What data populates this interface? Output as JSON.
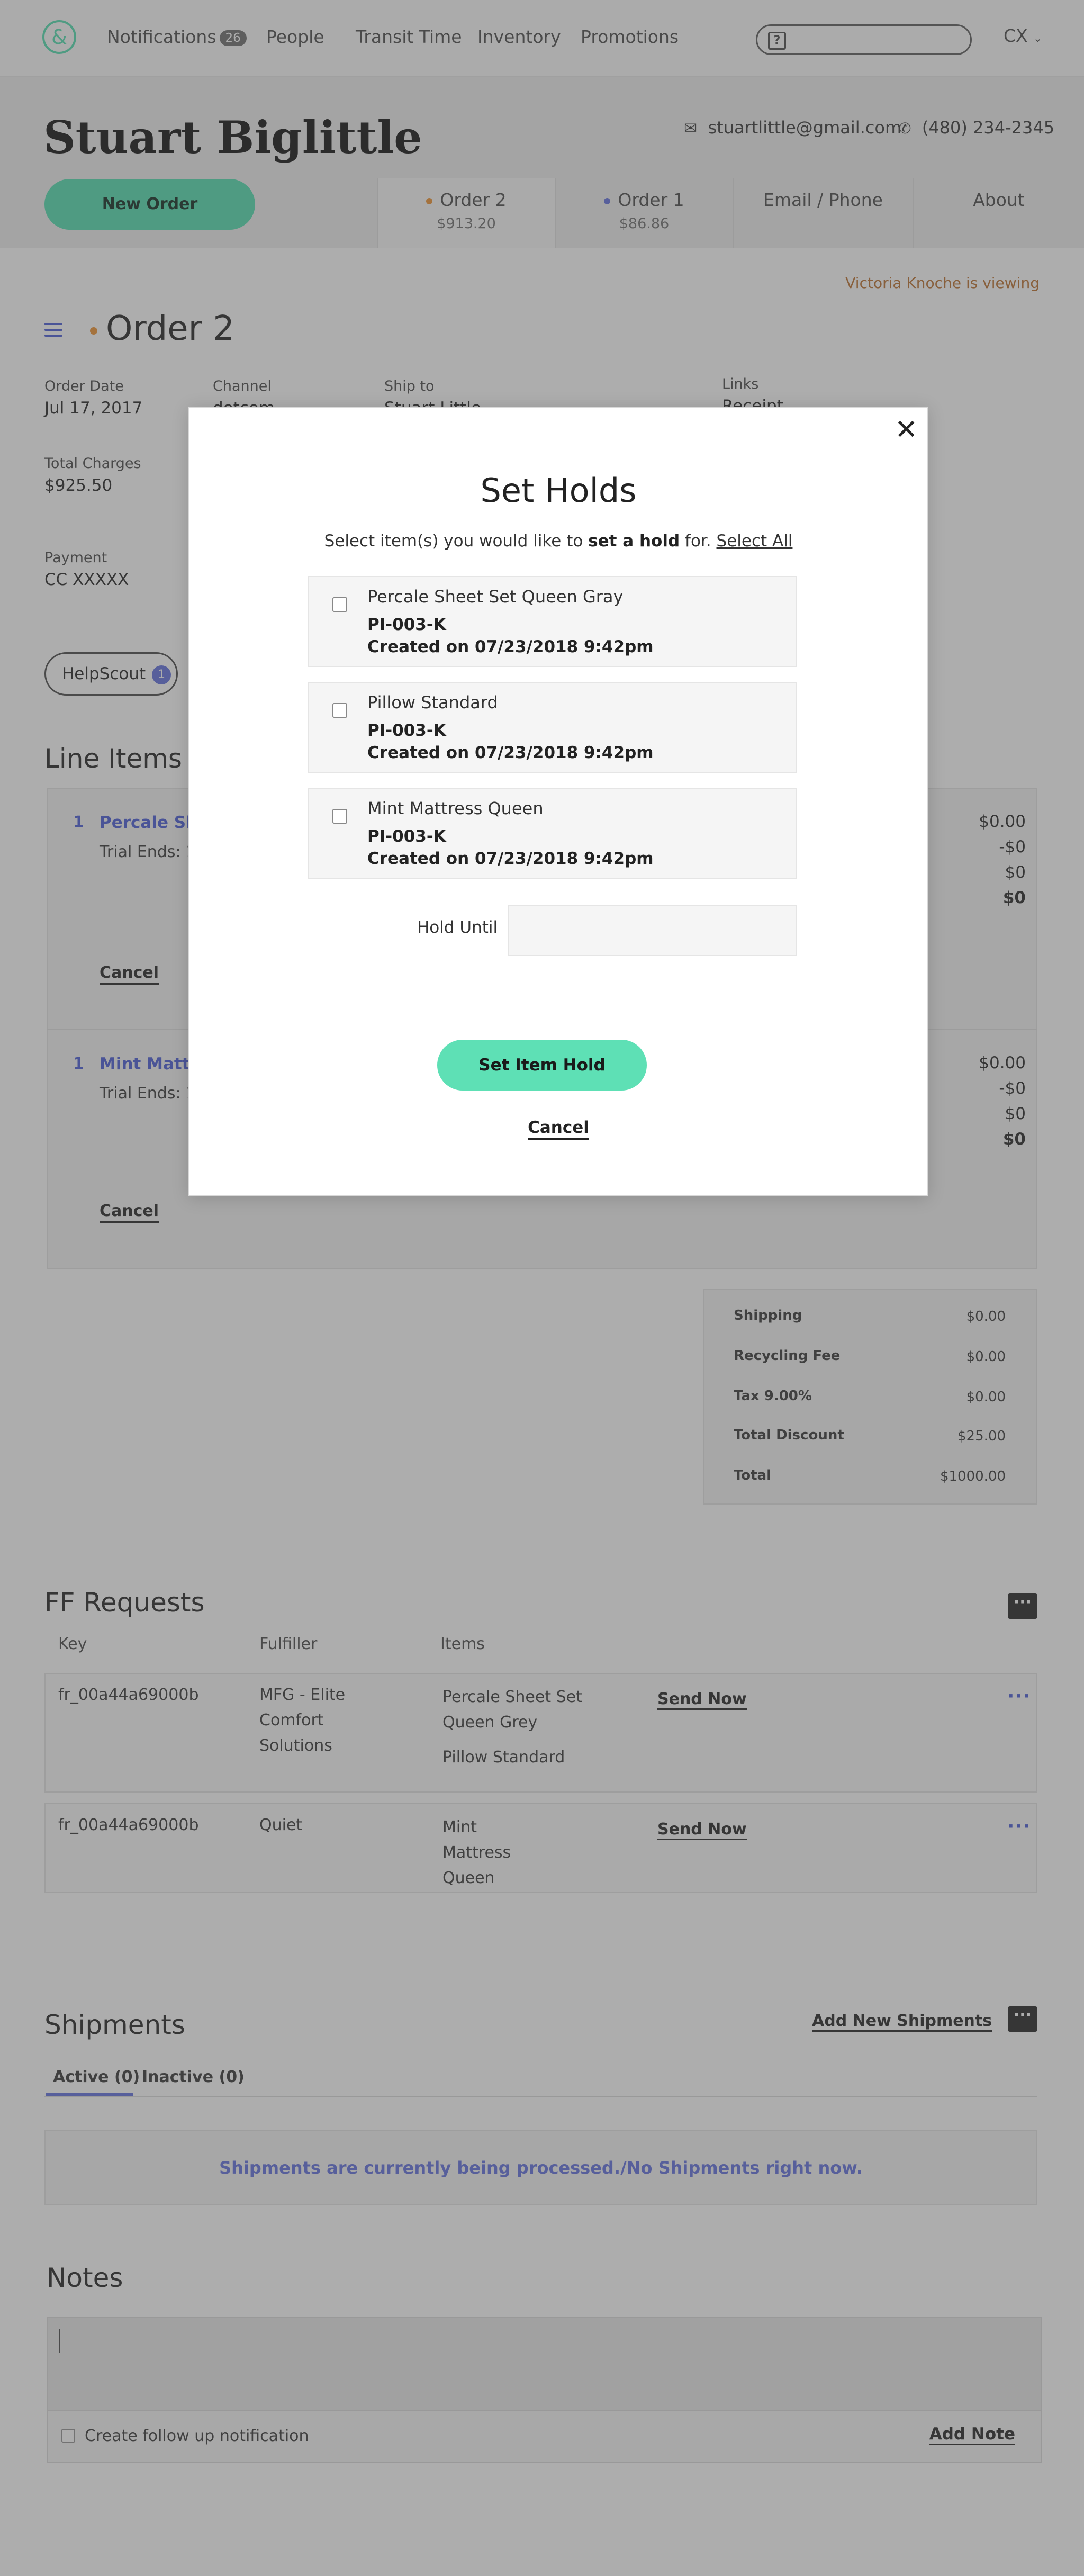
{
  "nav": {
    "logo": "&",
    "items": [
      "Notifications",
      "People",
      "Transit Time",
      "Inventory",
      "Promotions"
    ],
    "notif_count": "26",
    "search_icon": "?",
    "user_menu": "CX"
  },
  "customer": {
    "name": "Stuart Biglittle",
    "email": "stuartlittle@gmail.com",
    "phone": "(480) 234-2345",
    "new_order": "New Order"
  },
  "tabs": [
    {
      "label": "Order 2",
      "sub": "$913.20",
      "dot_color": "#f09a3e"
    },
    {
      "label": "Order 1",
      "sub": "$86.86",
      "dot_color": "#6b79e0"
    },
    {
      "label": "Email / Phone"
    },
    {
      "label": "About"
    }
  ],
  "viewing": "Victoria Knoche is viewing",
  "order": {
    "title": "Order 2",
    "date_label": "Order Date",
    "date": "Jul 17, 2017",
    "channel_label": "Channel",
    "channel": "dotcom",
    "shipto_label": "Ship to",
    "shipto": "Stuart Little",
    "links_label": "Links",
    "links": "Receipt",
    "charges_label": "Total Charges",
    "charges": "$925.50",
    "payment_label": "Payment",
    "payment": "CC XXXXX",
    "helpscout": "HelpScout",
    "helpscout_count": "1"
  },
  "line_items": {
    "title": "Line Items",
    "items": [
      {
        "qty": "1",
        "name": "Percale Sheet Set Queen Gray",
        "trial": "Trial Ends: 12",
        "amounts": [
          "$0.00",
          "-$0",
          "$0",
          "$0"
        ],
        "cancel": "Cancel"
      },
      {
        "qty": "1",
        "name": "Mint Mattress Queen",
        "trial": "Trial Ends: 12",
        "amounts": [
          "$0.00",
          "-$0",
          "$0",
          "$0"
        ],
        "cancel": "Cancel"
      }
    ]
  },
  "totals": [
    {
      "label": "Shipping",
      "value": "$0.00"
    },
    {
      "label": "Recycling Fee",
      "value": "$0.00"
    },
    {
      "label": "Tax 9.00%",
      "value": "$0.00"
    },
    {
      "label": "Total Discount",
      "value": "$25.00"
    },
    {
      "label": "Total",
      "value": "$1000.00"
    }
  ],
  "ff": {
    "title": "FF Requests",
    "more": "···",
    "headers": [
      "Key",
      "Fulfiller",
      "Items"
    ],
    "rows": [
      {
        "key": "fr_00a44a69000b",
        "fulfiller": "MFG - Elite Comfort Solutions",
        "items": [
          "Percale Sheet Set Queen Grey",
          "Pillow Standard"
        ],
        "action": "Send Now",
        "dots": "···"
      },
      {
        "key": "fr_00a44a69000b",
        "fulfiller": "Quiet",
        "items": [
          "Mint Mattress Queen"
        ],
        "action": "Send Now",
        "dots": "···"
      }
    ]
  },
  "shipments": {
    "title": "Shipments",
    "add": "Add New Shipments",
    "more": "···",
    "tab_active": "Active (0)",
    "tab_inactive": "Inactive (0)",
    "message": "Shipments are currently being processed./No Shipments right now."
  },
  "notes": {
    "title": "Notes",
    "followup": "Create follow up notification",
    "add": "Add Note"
  },
  "modal": {
    "close": "✕",
    "title": "Set Holds",
    "sub_pre": "Select item(s) you would like to ",
    "sub_bold": "set a hold",
    "sub_post": " for. ",
    "select_all": "Select All",
    "items": [
      {
        "name": "Percale Sheet Set Queen Gray",
        "sku": "PI-003-K",
        "created": "Created on 07/23/2018 9:42pm"
      },
      {
        "name": "Pillow Standard",
        "sku": "PI-003-K",
        "created": "Created on 07/23/2018 9:42pm"
      },
      {
        "name": "Mint Mattress Queen",
        "sku": "PI-003-K",
        "created": "Created on 07/23/2018 9:42pm"
      }
    ],
    "hold_until": "Hold Until",
    "hold_value": "",
    "submit": "Set Item Hold",
    "cancel": "Cancel"
  }
}
